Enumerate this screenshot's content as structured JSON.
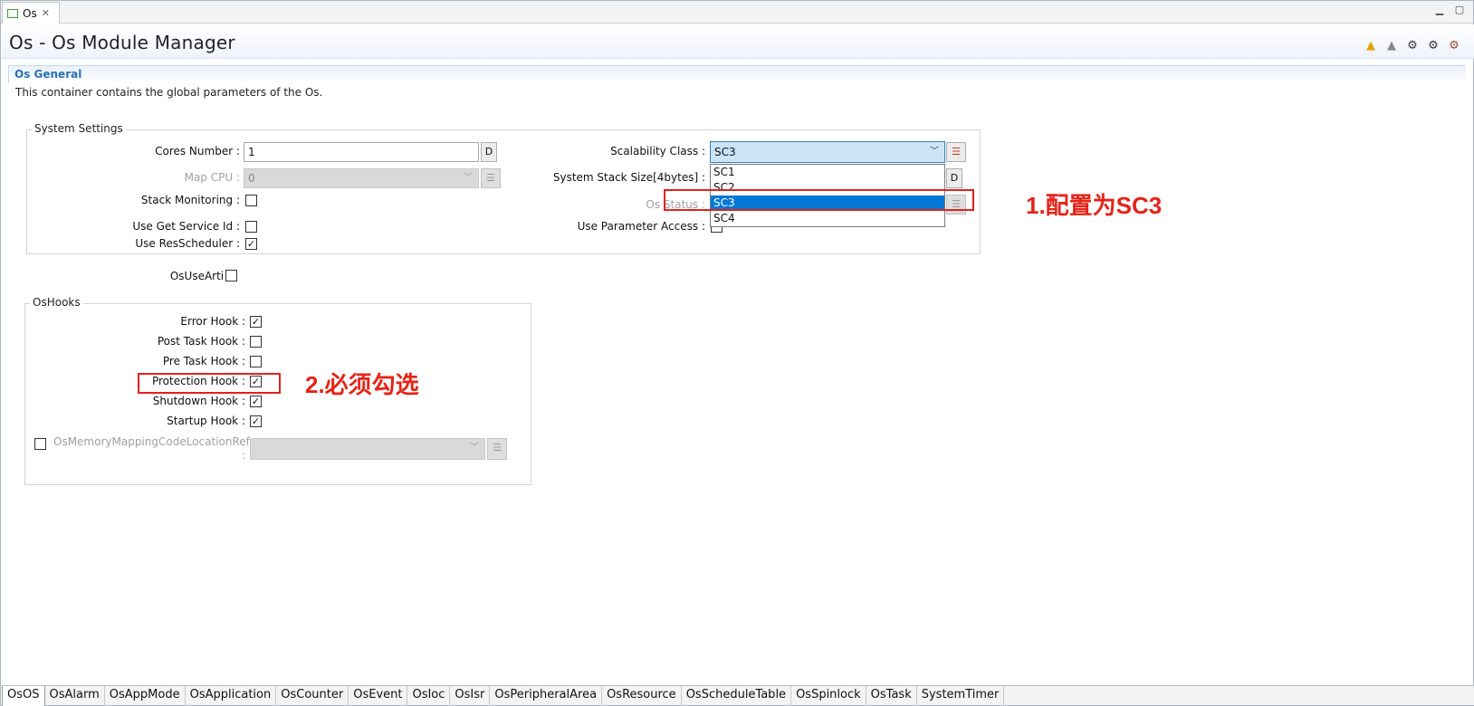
{
  "editor_tab": {
    "label": "Os",
    "file_icon": "config-file-icon",
    "close_icon": "close-icon"
  },
  "window_controls": {
    "minimize": "▭",
    "maximize": "▢"
  },
  "header": {
    "title": "Os - Os Module Manager",
    "icons": [
      "warning-icon",
      "warning-gray-icon",
      "settings-gear-icon",
      "generate-gears-icon",
      "validate-gear-icon"
    ]
  },
  "section": {
    "title": "Os General",
    "description": "This container contains the global parameters of the Os."
  },
  "system_settings": {
    "title": "System Settings",
    "cores_number": {
      "label": "Cores Number :",
      "value": "1",
      "default_button": "D"
    },
    "map_cpu": {
      "label": "Map CPU :",
      "value": "0"
    },
    "stack_monitoring": {
      "label": "Stack Monitoring :",
      "checked": false
    },
    "use_get_service_id": {
      "label": "Use Get Service Id :",
      "checked": false
    },
    "use_resscheduler": {
      "label": "Use ResScheduler :",
      "checked": true
    },
    "scalability_class": {
      "label": "Scalability Class :",
      "value": "SC3",
      "options": [
        "SC1",
        "SC2",
        "SC3",
        "SC4"
      ],
      "selected_index": 2
    },
    "system_stack_size": {
      "label": "System Stack Size[4bytes] :",
      "default_button": "D"
    },
    "os_status": {
      "label": "Os Status :"
    },
    "use_parameter_access": {
      "label": "Use Parameter Access :",
      "checked": false
    }
  },
  "os_use_arti": {
    "label": "OsUseArti :",
    "checked": false
  },
  "os_hooks": {
    "title": "OsHooks",
    "items": [
      {
        "label": "Error Hook :",
        "checked": true
      },
      {
        "label": "Post Task Hook :",
        "checked": false
      },
      {
        "label": "Pre Task Hook :",
        "checked": false
      },
      {
        "label": "Protection Hook :",
        "checked": true
      },
      {
        "label": "Shutdown Hook :",
        "checked": true
      },
      {
        "label": "Startup Hook :",
        "checked": true
      }
    ],
    "memory_mapping": {
      "label_line1": "OsMemoryMappingCodeLocationRef",
      "label_line2": ":",
      "checked": false
    }
  },
  "annotations": {
    "note1": "1.配置为SC3",
    "note2": "2.必须勾选"
  },
  "bottom_tabs": [
    "OsOS",
    "OsAlarm",
    "OsAppMode",
    "OsApplication",
    "OsCounter",
    "OsEvent",
    "OsIoc",
    "OsIsr",
    "OsPeripheralArea",
    "OsResource",
    "OsScheduleTable",
    "OsSpinlock",
    "OsTask",
    "SystemTimer"
  ],
  "colors": {
    "accent": "#2a6fb8",
    "selection": "#0078d7",
    "annotation_red": "#e62317"
  }
}
